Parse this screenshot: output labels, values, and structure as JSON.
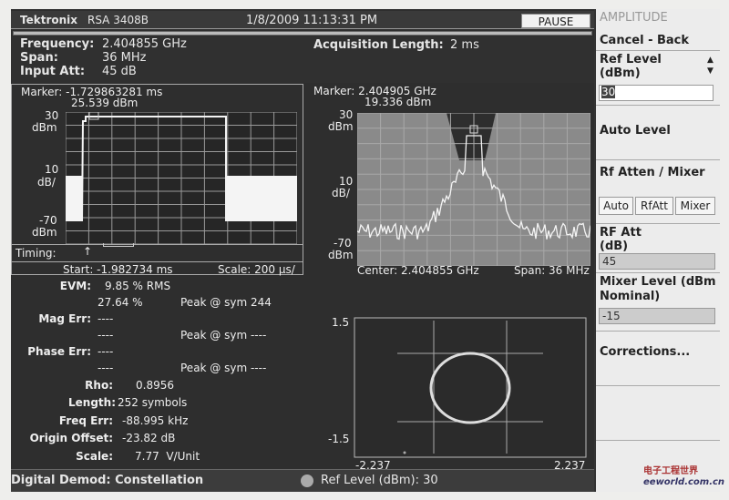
{
  "header": {
    "brand": "Tektronix",
    "model": "RSA 3408B",
    "datetime": "1/8/2009 11:13:31 PM",
    "pause_label": "PAUSE"
  },
  "info": {
    "frequency_label": "Frequency:",
    "frequency": "2.404855 GHz",
    "span_label": "Span:",
    "span": "36 MHz",
    "input_att_label": "Input Att:",
    "input_att": "45 dB",
    "acq_label": "Acquisition Length:",
    "acq": "2 ms"
  },
  "time_plot": {
    "marker": "Marker: -1.729863281 ms",
    "marker_level": "25.539 dBm",
    "y_top": "30",
    "y_top_unit": "dBm",
    "y_div": "10",
    "y_div_unit": "dB/",
    "y_bottom": "-70",
    "y_bottom_unit": "dBm",
    "timing_label": "Timing:",
    "start": "Start: -1.982734 ms",
    "scale": "Scale: 200 µs/"
  },
  "spectrum_plot": {
    "marker": "Marker: 2.404905 GHz",
    "marker_level": "19.336 dBm",
    "y_top": "30",
    "y_top_unit": "dBm",
    "y_div": "10",
    "y_div_unit": "dB/",
    "y_bottom": "-70",
    "y_bottom_unit": "dBm",
    "center": "Center: 2.404855 GHz",
    "span": "Span: 36 MHz"
  },
  "measurements": {
    "evm_label": "EVM:",
    "evm_rms": "9.85 % RMS",
    "evm_peak": "27.64 %",
    "evm_peak_sym": "Peak @ sym 244",
    "mag_err_label": "Mag Err:",
    "mag_err": "----",
    "mag_err_peak": "----",
    "mag_err_peak_sym": "Peak @ sym ----",
    "phase_err_label": "Phase Err:",
    "phase_err": "----",
    "phase_err_peak": "----",
    "phase_err_peak_sym": "Peak @ sym ----",
    "rho_label": "Rho:",
    "rho": "0.8956",
    "length_label": "Length:",
    "length": "252 symbols",
    "freq_err_label": "Freq Err:",
    "freq_err": "-88.995 kHz",
    "origin_offset_label": "Origin Offset:",
    "origin_offset": "-23.82 dB",
    "scale_label": "Scale:",
    "scale": "7.77  V/Unit"
  },
  "constellation": {
    "y_max": "1.5",
    "y_min": "-1.5",
    "x_min": "-2.237",
    "x_max": "2.237"
  },
  "status": {
    "mode": "Digital Demod: Constellation",
    "ref_level": "Ref Level (dBm): 30"
  },
  "menu": {
    "title": "AMPLITUDE",
    "cancel_back": "Cancel - Back",
    "ref_level_label": "Ref Level (dBm)",
    "ref_level_value": "30",
    "auto_level": "Auto Level",
    "rf_atten_mixer": "Rf Atten / Mixer",
    "seg_auto": "Auto",
    "seg_rfatt": "RfAtt",
    "seg_mixer": "Mixer",
    "rf_att_label": "RF Att (dB)",
    "rf_att_value": "45",
    "mixer_level_label": "Mixer Level (dBm Nominal)",
    "mixer_level_value": "-15",
    "corrections": "Corrections..."
  },
  "watermark": {
    "text": "电子工程世界 eeworld.com.cn"
  }
}
